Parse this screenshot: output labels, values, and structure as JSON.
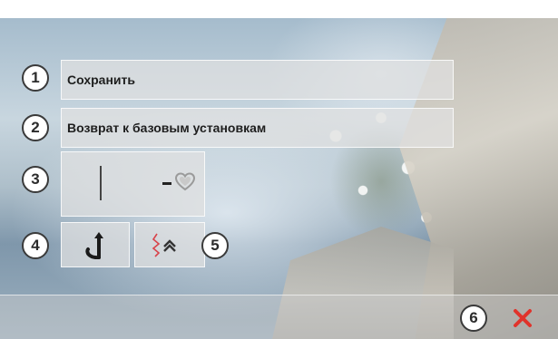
{
  "menu": {
    "save_label": "Сохранить",
    "reset_label": "Возврат к базовым установкам"
  },
  "callouts": {
    "n1": "1",
    "n2": "2",
    "n3": "3",
    "n4": "4",
    "n5": "5",
    "n6": "6"
  },
  "icons": {
    "needle": "needle-position-line-icon",
    "heart": "heart-pattern-icon",
    "tie_off": "tie-off-hook-icon",
    "pattern_end": "pattern-end-icon",
    "close": "close-icon"
  },
  "colors": {
    "close_red": "#e0332b",
    "pattern_red": "#d8434a",
    "heart_grey": "#9a9a9a"
  }
}
